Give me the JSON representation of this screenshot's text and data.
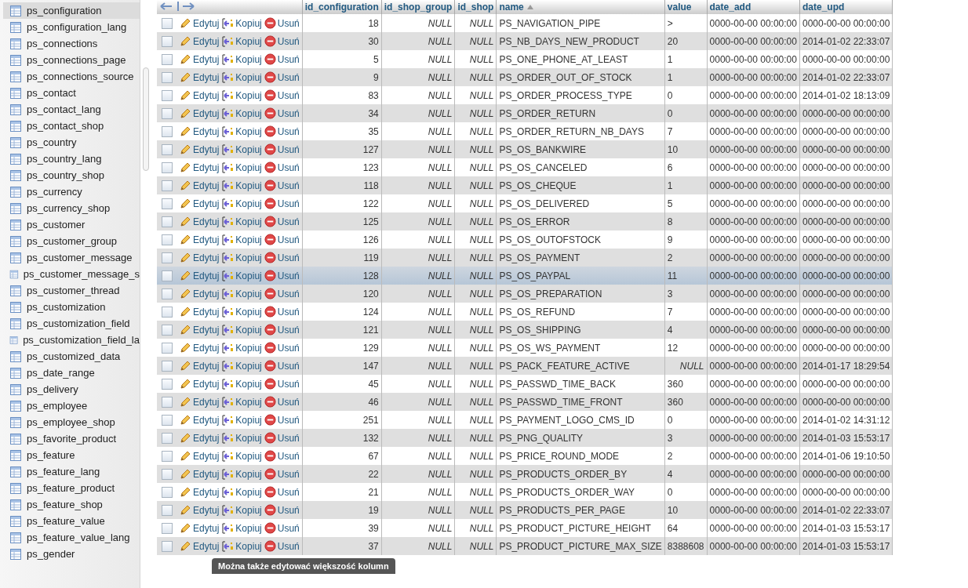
{
  "sidebar": {
    "items": [
      {
        "label": "ps_configuration",
        "selected": true
      },
      {
        "label": "ps_configuration_lang",
        "selected": false
      },
      {
        "label": "ps_connections",
        "selected": false
      },
      {
        "label": "ps_connections_page",
        "selected": false
      },
      {
        "label": "ps_connections_source",
        "selected": false
      },
      {
        "label": "ps_contact",
        "selected": false
      },
      {
        "label": "ps_contact_lang",
        "selected": false
      },
      {
        "label": "ps_contact_shop",
        "selected": false
      },
      {
        "label": "ps_country",
        "selected": false
      },
      {
        "label": "ps_country_lang",
        "selected": false
      },
      {
        "label": "ps_country_shop",
        "selected": false
      },
      {
        "label": "ps_currency",
        "selected": false
      },
      {
        "label": "ps_currency_shop",
        "selected": false
      },
      {
        "label": "ps_customer",
        "selected": false
      },
      {
        "label": "ps_customer_group",
        "selected": false
      },
      {
        "label": "ps_customer_message",
        "selected": false
      },
      {
        "label": "ps_customer_message_s",
        "selected": false
      },
      {
        "label": "ps_customer_thread",
        "selected": false
      },
      {
        "label": "ps_customization",
        "selected": false
      },
      {
        "label": "ps_customization_field",
        "selected": false
      },
      {
        "label": "ps_customization_field_la",
        "selected": false
      },
      {
        "label": "ps_customized_data",
        "selected": false
      },
      {
        "label": "ps_date_range",
        "selected": false
      },
      {
        "label": "ps_delivery",
        "selected": false
      },
      {
        "label": "ps_employee",
        "selected": false
      },
      {
        "label": "ps_employee_shop",
        "selected": false
      },
      {
        "label": "ps_favorite_product",
        "selected": false
      },
      {
        "label": "ps_feature",
        "selected": false
      },
      {
        "label": "ps_feature_lang",
        "selected": false
      },
      {
        "label": "ps_feature_product",
        "selected": false
      },
      {
        "label": "ps_feature_shop",
        "selected": false
      },
      {
        "label": "ps_feature_value",
        "selected": false
      },
      {
        "label": "ps_feature_value_lang",
        "selected": false
      },
      {
        "label": "ps_gender",
        "selected": false
      }
    ]
  },
  "table": {
    "columns": [
      {
        "label": "id_configuration",
        "sorted": false
      },
      {
        "label": "id_shop_group",
        "sorted": false
      },
      {
        "label": "id_shop",
        "sorted": false
      },
      {
        "label": "name",
        "sorted": true
      },
      {
        "label": "value",
        "sorted": false
      },
      {
        "label": "date_add",
        "sorted": false
      },
      {
        "label": "date_upd",
        "sorted": false
      }
    ],
    "rows": [
      {
        "checked": false,
        "selected": false,
        "actions": [
          "Edytuj",
          "Kopiuj",
          "Usuń"
        ],
        "cells": [
          "18",
          "NULL",
          "NULL",
          "PS_NAVIGATION_PIPE",
          ">",
          "0000-00-00 00:00:00",
          "0000-00-00 00:00:00"
        ],
        "value_null": false
      },
      {
        "checked": false,
        "selected": false,
        "actions": [
          "Edytuj",
          "Kopiuj",
          "Usuń"
        ],
        "cells": [
          "30",
          "NULL",
          "NULL",
          "PS_NB_DAYS_NEW_PRODUCT",
          "20",
          "0000-00-00 00:00:00",
          "2014-01-02 22:33:07"
        ],
        "value_null": false
      },
      {
        "checked": false,
        "selected": false,
        "actions": [
          "Edytuj",
          "Kopiuj",
          "Usuń"
        ],
        "cells": [
          "5",
          "NULL",
          "NULL",
          "PS_ONE_PHONE_AT_LEAST",
          "1",
          "0000-00-00 00:00:00",
          "0000-00-00 00:00:00"
        ],
        "value_null": false
      },
      {
        "checked": false,
        "selected": false,
        "actions": [
          "Edytuj",
          "Kopiuj",
          "Usuń"
        ],
        "cells": [
          "9",
          "NULL",
          "NULL",
          "PS_ORDER_OUT_OF_STOCK",
          "1",
          "0000-00-00 00:00:00",
          "2014-01-02 22:33:07"
        ],
        "value_null": false
      },
      {
        "checked": false,
        "selected": false,
        "actions": [
          "Edytuj",
          "Kopiuj",
          "Usuń"
        ],
        "cells": [
          "83",
          "NULL",
          "NULL",
          "PS_ORDER_PROCESS_TYPE",
          "0",
          "0000-00-00 00:00:00",
          "2014-01-02 18:13:09"
        ],
        "value_null": false
      },
      {
        "checked": false,
        "selected": false,
        "actions": [
          "Edytuj",
          "Kopiuj",
          "Usuń"
        ],
        "cells": [
          "34",
          "NULL",
          "NULL",
          "PS_ORDER_RETURN",
          "0",
          "0000-00-00 00:00:00",
          "0000-00-00 00:00:00"
        ],
        "value_null": false
      },
      {
        "checked": false,
        "selected": false,
        "actions": [
          "Edytuj",
          "Kopiuj",
          "Usuń"
        ],
        "cells": [
          "35",
          "NULL",
          "NULL",
          "PS_ORDER_RETURN_NB_DAYS",
          "7",
          "0000-00-00 00:00:00",
          "0000-00-00 00:00:00"
        ],
        "value_null": false
      },
      {
        "checked": false,
        "selected": false,
        "actions": [
          "Edytuj",
          "Kopiuj",
          "Usuń"
        ],
        "cells": [
          "127",
          "NULL",
          "NULL",
          "PS_OS_BANKWIRE",
          "10",
          "0000-00-00 00:00:00",
          "0000-00-00 00:00:00"
        ],
        "value_null": false
      },
      {
        "checked": false,
        "selected": false,
        "actions": [
          "Edytuj",
          "Kopiuj",
          "Usuń"
        ],
        "cells": [
          "123",
          "NULL",
          "NULL",
          "PS_OS_CANCELED",
          "6",
          "0000-00-00 00:00:00",
          "0000-00-00 00:00:00"
        ],
        "value_null": false
      },
      {
        "checked": false,
        "selected": false,
        "actions": [
          "Edytuj",
          "Kopiuj",
          "Usuń"
        ],
        "cells": [
          "118",
          "NULL",
          "NULL",
          "PS_OS_CHEQUE",
          "1",
          "0000-00-00 00:00:00",
          "0000-00-00 00:00:00"
        ],
        "value_null": false
      },
      {
        "checked": false,
        "selected": false,
        "actions": [
          "Edytuj",
          "Kopiuj",
          "Usuń"
        ],
        "cells": [
          "122",
          "NULL",
          "NULL",
          "PS_OS_DELIVERED",
          "5",
          "0000-00-00 00:00:00",
          "0000-00-00 00:00:00"
        ],
        "value_null": false
      },
      {
        "checked": false,
        "selected": false,
        "actions": [
          "Edytuj",
          "Kopiuj",
          "Usuń"
        ],
        "cells": [
          "125",
          "NULL",
          "NULL",
          "PS_OS_ERROR",
          "8",
          "0000-00-00 00:00:00",
          "0000-00-00 00:00:00"
        ],
        "value_null": false
      },
      {
        "checked": false,
        "selected": false,
        "actions": [
          "Edytuj",
          "Kopiuj",
          "Usuń"
        ],
        "cells": [
          "126",
          "NULL",
          "NULL",
          "PS_OS_OUTOFSTOCK",
          "9",
          "0000-00-00 00:00:00",
          "0000-00-00 00:00:00"
        ],
        "value_null": false
      },
      {
        "checked": false,
        "selected": false,
        "actions": [
          "Edytuj",
          "Kopiuj",
          "Usuń"
        ],
        "cells": [
          "119",
          "NULL",
          "NULL",
          "PS_OS_PAYMENT",
          "2",
          "0000-00-00 00:00:00",
          "0000-00-00 00:00:00"
        ],
        "value_null": false
      },
      {
        "checked": false,
        "selected": true,
        "actions": [
          "Edytuj",
          "Kopiuj",
          "Usuń"
        ],
        "cells": [
          "128",
          "NULL",
          "NULL",
          "PS_OS_PAYPAL",
          "11",
          "0000-00-00 00:00:00",
          "0000-00-00 00:00:00"
        ],
        "value_null": false
      },
      {
        "checked": false,
        "selected": false,
        "actions": [
          "Edytuj",
          "Kopiuj",
          "Usuń"
        ],
        "cells": [
          "120",
          "NULL",
          "NULL",
          "PS_OS_PREPARATION",
          "3",
          "0000-00-00 00:00:00",
          "0000-00-00 00:00:00"
        ],
        "value_null": false
      },
      {
        "checked": false,
        "selected": false,
        "actions": [
          "Edytuj",
          "Kopiuj",
          "Usuń"
        ],
        "cells": [
          "124",
          "NULL",
          "NULL",
          "PS_OS_REFUND",
          "7",
          "0000-00-00 00:00:00",
          "0000-00-00 00:00:00"
        ],
        "value_null": false
      },
      {
        "checked": false,
        "selected": false,
        "actions": [
          "Edytuj",
          "Kopiuj",
          "Usuń"
        ],
        "cells": [
          "121",
          "NULL",
          "NULL",
          "PS_OS_SHIPPING",
          "4",
          "0000-00-00 00:00:00",
          "0000-00-00 00:00:00"
        ],
        "value_null": false
      },
      {
        "checked": false,
        "selected": false,
        "actions": [
          "Edytuj",
          "Kopiuj",
          "Usuń"
        ],
        "cells": [
          "129",
          "NULL",
          "NULL",
          "PS_OS_WS_PAYMENT",
          "12",
          "0000-00-00 00:00:00",
          "0000-00-00 00:00:00"
        ],
        "value_null": false
      },
      {
        "checked": false,
        "selected": false,
        "actions": [
          "Edytuj",
          "Kopiuj",
          "Usuń"
        ],
        "cells": [
          "147",
          "NULL",
          "NULL",
          "PS_PACK_FEATURE_ACTIVE",
          "NULL",
          "0000-00-00 00:00:00",
          "2014-01-17 18:29:54"
        ],
        "value_null": true
      },
      {
        "checked": false,
        "selected": false,
        "actions": [
          "Edytuj",
          "Kopiuj",
          "Usuń"
        ],
        "cells": [
          "45",
          "NULL",
          "NULL",
          "PS_PASSWD_TIME_BACK",
          "360",
          "0000-00-00 00:00:00",
          "0000-00-00 00:00:00"
        ],
        "value_null": false
      },
      {
        "checked": false,
        "selected": false,
        "actions": [
          "Edytuj",
          "Kopiuj",
          "Usuń"
        ],
        "cells": [
          "46",
          "NULL",
          "NULL",
          "PS_PASSWD_TIME_FRONT",
          "360",
          "0000-00-00 00:00:00",
          "0000-00-00 00:00:00"
        ],
        "value_null": false
      },
      {
        "checked": false,
        "selected": false,
        "actions": [
          "Edytuj",
          "Kopiuj",
          "Usuń"
        ],
        "cells": [
          "251",
          "NULL",
          "NULL",
          "PS_PAYMENT_LOGO_CMS_ID",
          "0",
          "0000-00-00 00:00:00",
          "2014-01-02 14:31:12"
        ],
        "value_null": false
      },
      {
        "checked": false,
        "selected": false,
        "actions": [
          "Edytuj",
          "Kopiuj",
          "Usuń"
        ],
        "cells": [
          "132",
          "NULL",
          "NULL",
          "PS_PNG_QUALITY",
          "3",
          "0000-00-00 00:00:00",
          "2014-01-03 15:53:17"
        ],
        "value_null": false
      },
      {
        "checked": false,
        "selected": false,
        "actions": [
          "Edytuj",
          "Kopiuj",
          "Usuń"
        ],
        "cells": [
          "67",
          "NULL",
          "NULL",
          "PS_PRICE_ROUND_MODE",
          "2",
          "0000-00-00 00:00:00",
          "2014-01-06 19:10:50"
        ],
        "value_null": false
      },
      {
        "checked": false,
        "selected": false,
        "actions": [
          "Edytuj",
          "Kopiuj",
          "Usuń"
        ],
        "cells": [
          "22",
          "NULL",
          "NULL",
          "PS_PRODUCTS_ORDER_BY",
          "4",
          "0000-00-00 00:00:00",
          "0000-00-00 00:00:00"
        ],
        "value_null": false
      },
      {
        "checked": false,
        "selected": false,
        "actions": [
          "Edytuj",
          "Kopiuj",
          "Usuń"
        ],
        "cells": [
          "21",
          "NULL",
          "NULL",
          "PS_PRODUCTS_ORDER_WAY",
          "0",
          "0000-00-00 00:00:00",
          "0000-00-00 00:00:00"
        ],
        "value_null": false
      },
      {
        "checked": false,
        "selected": false,
        "actions": [
          "Edytuj",
          "Kopiuj",
          "Usuń"
        ],
        "cells": [
          "19",
          "NULL",
          "NULL",
          "PS_PRODUCTS_PER_PAGE",
          "10",
          "0000-00-00 00:00:00",
          "2014-01-02 22:33:07"
        ],
        "value_null": false
      },
      {
        "checked": false,
        "selected": false,
        "actions": [
          "Edytuj",
          "Kopiuj",
          "Usuń"
        ],
        "cells": [
          "39",
          "NULL",
          "NULL",
          "PS_PRODUCT_PICTURE_HEIGHT",
          "64",
          "0000-00-00 00:00:00",
          "2014-01-03 15:53:17"
        ],
        "value_null": false
      },
      {
        "checked": false,
        "selected": false,
        "actions": [
          "Edytuj",
          "Kopiuj",
          "Usuń"
        ],
        "cells": [
          "37",
          "NULL",
          "NULL",
          "PS_PRODUCT_PICTURE_MAX_SIZE",
          "8388608",
          "0000-00-00 00:00:00",
          "2014-01-03 15:53:17"
        ],
        "value_null": false
      }
    ]
  },
  "tooltip": {
    "text": "Można także edytować większość kolumn"
  }
}
